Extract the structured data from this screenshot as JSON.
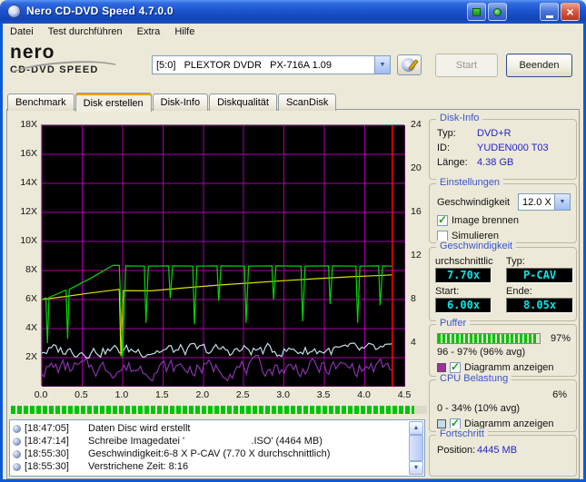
{
  "window": {
    "title": "Nero CD-DVD Speed 4.7.0.0"
  },
  "menu": {
    "items": [
      "Datei",
      "Test durchführen",
      "Extra",
      "Hilfe"
    ]
  },
  "toolbar": {
    "logo_top": "nero",
    "logo_bottom": "CD-DVD SPEED",
    "drive": "[5:0]   PLEXTOR DVDR   PX-716A 1.09",
    "start": "Start",
    "quit": "Beenden"
  },
  "tabs": [
    {
      "label": "Benchmark",
      "active": false
    },
    {
      "label": "Disk erstellen",
      "active": true
    },
    {
      "label": "Disk-Info",
      "active": false
    },
    {
      "label": "Diskqualität",
      "active": false
    },
    {
      "label": "ScanDisk",
      "active": false
    }
  ],
  "chart_data": {
    "type": "line",
    "title": "",
    "x_range": [
      0,
      4.5
    ],
    "x_ticks": [
      "0.0",
      "0.5",
      "1.0",
      "1.5",
      "2.0",
      "2.5",
      "3.0",
      "3.5",
      "4.0",
      "4.5"
    ],
    "left_axis": {
      "range": [
        0,
        18
      ],
      "ticks": [
        "18X",
        "16X",
        "14X",
        "12X",
        "10X",
        "8X",
        "6X",
        "4X",
        "2X"
      ]
    },
    "right_axis": {
      "range": [
        0,
        24
      ],
      "ticks": [
        "24",
        "20",
        "16",
        "12",
        "8",
        "4"
      ]
    },
    "grid": {
      "color": "#a800a8",
      "bg": "#000000",
      "x_step": 0.5,
      "y_step": 2
    },
    "position_line": {
      "x": 4.34,
      "color": "#ff0000"
    },
    "series": [
      {
        "name": "buffer",
        "color": "#8833aa",
        "kind": "noise",
        "min": 0.25,
        "max": 2.3,
        "seed": 7,
        "n": 150,
        "x_end": 4.34
      },
      {
        "name": "cpu",
        "color": "#c2dde8",
        "kind": "noise",
        "min": 1.75,
        "max": 3.25,
        "seed": 3,
        "n": 150,
        "x_end": 4.34
      },
      {
        "name": "average_speed",
        "color": "#e0e000",
        "kind": "line",
        "points": [
          [
            0,
            6.0
          ],
          [
            0.3,
            6.22
          ],
          [
            0.6,
            6.45
          ],
          [
            0.93,
            6.68
          ],
          [
            0.96,
            6.7
          ],
          [
            0.98,
            2.1
          ],
          [
            1.01,
            6.62
          ],
          [
            1.35,
            6.6
          ],
          [
            1.8,
            6.82
          ],
          [
            2.2,
            7.0
          ],
          [
            2.6,
            7.15
          ],
          [
            3.0,
            7.3
          ],
          [
            3.4,
            7.44
          ],
          [
            3.8,
            7.56
          ],
          [
            4.1,
            7.64
          ],
          [
            4.34,
            7.7
          ]
        ]
      },
      {
        "name": "write_speed",
        "color": "#00d800",
        "kind": "line",
        "points": [
          [
            0,
            6.0
          ],
          [
            0.05,
            6.12
          ],
          [
            0.07,
            3.0
          ],
          [
            0.09,
            6.15
          ],
          [
            0.3,
            6.65
          ],
          [
            0.32,
            3.3
          ],
          [
            0.34,
            6.7
          ],
          [
            0.6,
            7.45
          ],
          [
            0.88,
            8.35
          ],
          [
            0.96,
            8.35
          ],
          [
            1.0,
            2.0
          ],
          [
            1.04,
            8.32
          ],
          [
            1.27,
            8.3
          ],
          [
            1.29,
            4.4
          ],
          [
            1.32,
            8.3
          ],
          [
            1.57,
            8.32
          ],
          [
            1.59,
            6.1
          ],
          [
            1.62,
            8.32
          ],
          [
            1.87,
            8.3
          ],
          [
            1.89,
            4.3
          ],
          [
            1.92,
            8.3
          ],
          [
            2.17,
            8.32
          ],
          [
            2.19,
            5.9
          ],
          [
            2.22,
            8.32
          ],
          [
            2.51,
            8.3
          ],
          [
            2.53,
            4.4
          ],
          [
            2.56,
            8.3
          ],
          [
            2.85,
            8.32
          ],
          [
            2.87,
            6.0
          ],
          [
            2.9,
            8.32
          ],
          [
            3.21,
            8.3
          ],
          [
            3.23,
            4.5
          ],
          [
            3.26,
            8.3
          ],
          [
            3.55,
            8.32
          ],
          [
            3.57,
            5.7
          ],
          [
            3.6,
            8.32
          ],
          [
            3.89,
            8.3
          ],
          [
            3.91,
            4.4
          ],
          [
            3.94,
            8.3
          ],
          [
            4.17,
            8.32
          ],
          [
            4.19,
            5.6
          ],
          [
            4.22,
            8.32
          ],
          [
            4.34,
            8.3
          ]
        ]
      }
    ]
  },
  "buffer_strip": {
    "fill": 97
  },
  "panels": {
    "disk_info": {
      "title": "Disk-Info",
      "rows": [
        {
          "label": "Typ:",
          "value": "DVD+R"
        },
        {
          "label": "ID:",
          "value": "YUDEN000 T03"
        },
        {
          "label": "Länge:",
          "value": "4.38 GB"
        }
      ]
    },
    "einstellungen": {
      "title": "Einstellungen",
      "speed_label": "Geschwindigkeit",
      "speed_value": "12.0 X",
      "image_label": "Image brennen",
      "image_checked": true,
      "sim_label": "Simulieren",
      "sim_checked": false
    },
    "geschwindigkeit": {
      "title": "Geschwindigkeit",
      "avg_label": "urchschnittlic",
      "typ_label": "Typ:",
      "avg_value": "7.70x",
      "typ_value": "P-CAV",
      "start_label": "Start:",
      "start_value": "6.00x",
      "ende_label": "Ende:",
      "ende_value": "8.05x"
    },
    "puffer": {
      "title": "Puffer",
      "percent_text": "97%",
      "fill": 97,
      "range_text": "96 - 97% (96% avg)",
      "diagram_label": "Diagramm anzeigen",
      "diagram_checked": true
    },
    "cpu": {
      "title": "CPU Belastung",
      "percent_text": "6%",
      "range_text": "0 - 34% (10% avg)",
      "diagram_label": "Diagramm anzeigen",
      "diagram_checked": true
    },
    "fortschritt": {
      "title": "Fortschritt",
      "position_label": "Position:",
      "position_value": "4445 MB"
    }
  },
  "log": {
    "lines": [
      {
        "time": "[18:47:05]",
        "text": "Daten Disc wird erstellt"
      },
      {
        "time": "[18:47:14]",
        "text": "Schreibe Imagedatei '                        .ISO' (4464 MB)"
      },
      {
        "time": "[18:55:30]",
        "text": "Geschwindigkeit:6-8 X P-CAV (7.70 X durchschnittlich)"
      },
      {
        "time": "[18:55:30]",
        "text": "Verstrichene Zeit: 8:16"
      }
    ]
  },
  "colors": {
    "group_title": "#3a55cc",
    "value_text": "#2323cc",
    "lcd_text": "#00e8e8",
    "buffer_green": "#00c400",
    "swatch_buffer": "#993399",
    "swatch_cpu": "#c2dde8"
  }
}
